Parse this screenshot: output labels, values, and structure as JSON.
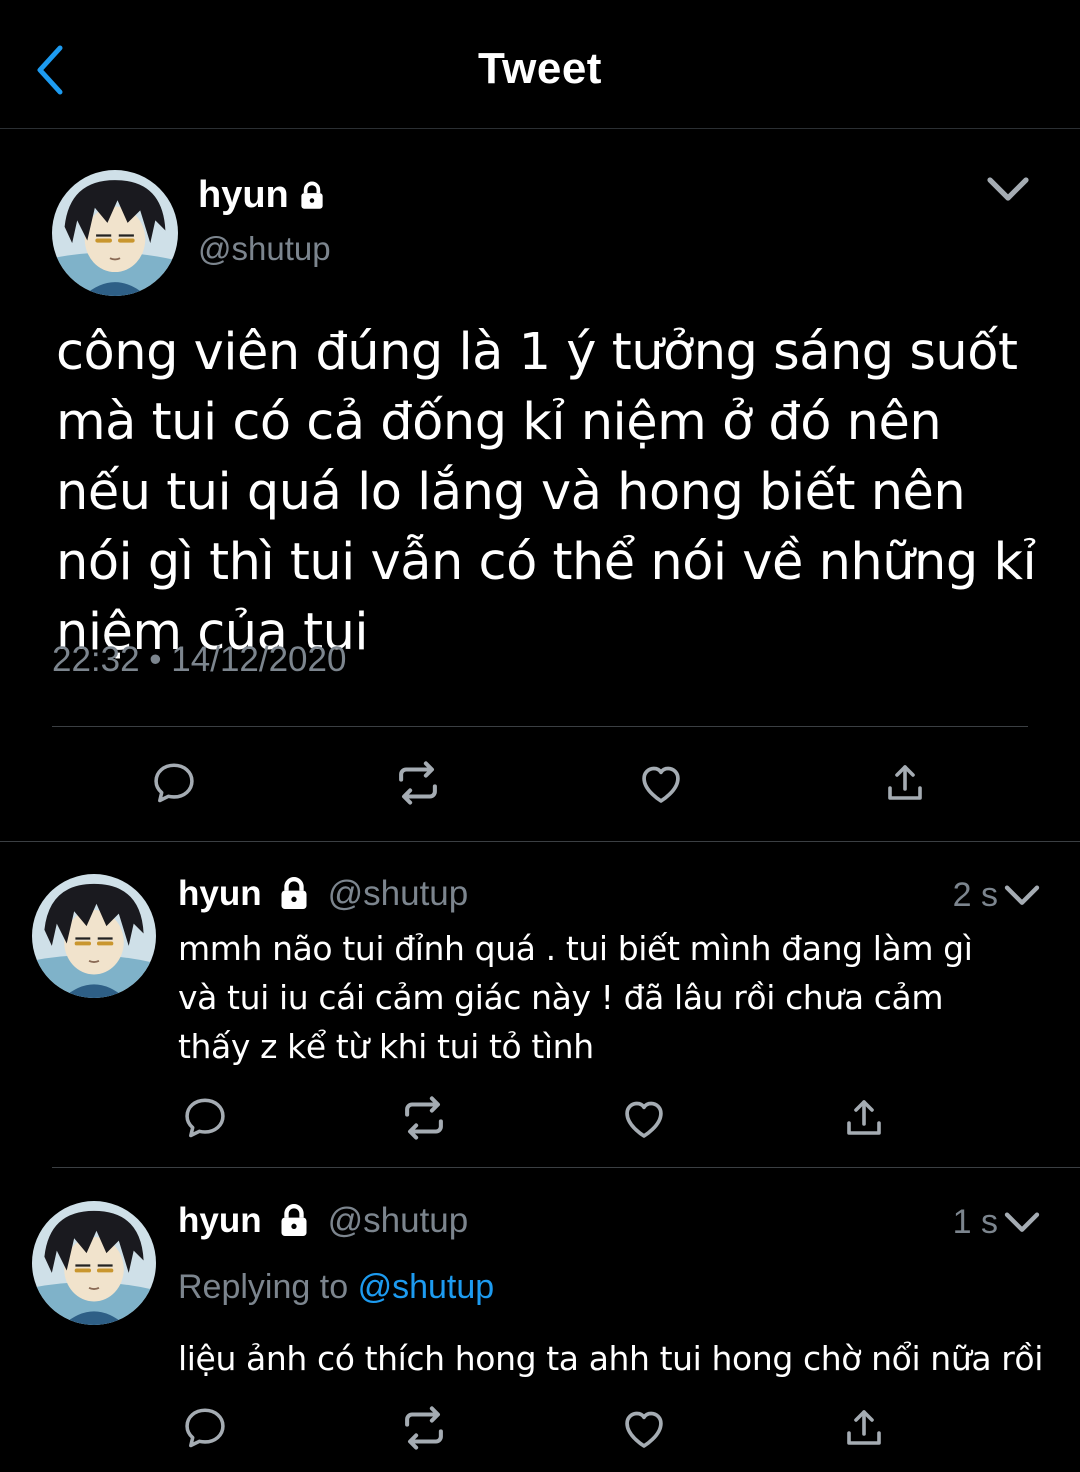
{
  "header": {
    "title": "Tweet"
  },
  "main_tweet": {
    "name": "hyun",
    "handle": "@shutup",
    "text": "công viên đúng là 1 ý tưởng sáng suốt mà tui có cả đống kỉ niệm ở đó nên nếu tui quá lo lắng và hong biết nên nói gì thì tui vẫn có thể nói về những kỉ niệm của tui",
    "timestamp": "22:32 • 14/12/2020"
  },
  "replies": [
    {
      "name": "hyun",
      "handle": "@shutup",
      "time": "2 s",
      "text": "mmh não tui đỉnh quá . tui biết mình đang làm gì và tui iu cái cảm giác này ! đã lâu rồi chưa cảm thấy z kể từ khi tui tỏ tình"
    },
    {
      "name": "hyun",
      "handle": "@shutup",
      "time": "1 s",
      "replying_prefix": "Replying to",
      "replying_mention": "@shutup",
      "text": "liệu ảnh có thích hong ta ahh tui hong chờ nổi nữa rồi"
    }
  ],
  "colors": {
    "accent": "#1d9bf0",
    "muted": "#7c858e",
    "background": "#000000"
  },
  "icons": [
    "back-arrow-icon",
    "lock-icon",
    "chevron-down-icon",
    "reply-icon",
    "retweet-icon",
    "like-icon",
    "share-icon"
  ]
}
